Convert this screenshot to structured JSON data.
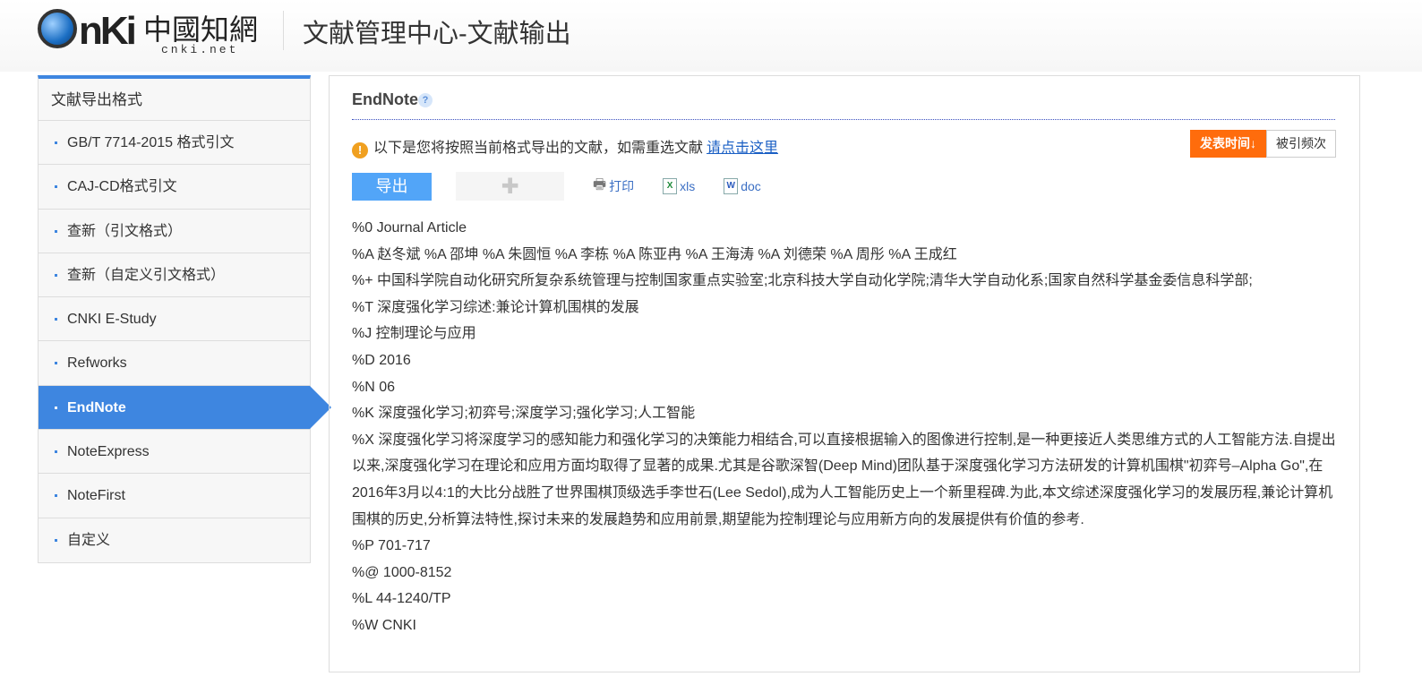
{
  "header": {
    "logo_text": "CNKI中国知网",
    "logo_sub": "cnki.net",
    "title": "文献管理中心-文献输出"
  },
  "sidebar": {
    "title": "文献导出格式",
    "items": [
      {
        "label": "GB/T 7714-2015 格式引文"
      },
      {
        "label": "CAJ-CD格式引文"
      },
      {
        "label": "查新（引文格式）"
      },
      {
        "label": "查新（自定义引文格式）"
      },
      {
        "label": "CNKI E-Study"
      },
      {
        "label": "Refworks"
      },
      {
        "label": "EndNote",
        "active": true
      },
      {
        "label": "NoteExpress"
      },
      {
        "label": "NoteFirst"
      },
      {
        "label": "自定义"
      }
    ]
  },
  "main": {
    "title": "EndNote",
    "help": "?",
    "notice": "以下是您将按照当前格式导出的文献，如需重选文献",
    "notice_link": "请点击这里",
    "sort": {
      "time": "发表时间↓",
      "cited": "被引频次"
    },
    "toolbar": {
      "export": "导出",
      "print": "打印",
      "xls": "xls",
      "doc": "doc"
    },
    "lines": [
      "%0 Journal Article",
      "%A 赵冬斌 %A 邵坤 %A 朱圆恒 %A 李栋 %A 陈亚冉 %A 王海涛 %A 刘德荣 %A 周彤 %A 王成红",
      "%+ 中国科学院自动化研究所复杂系统管理与控制国家重点实验室;北京科技大学自动化学院;清华大学自动化系;国家自然科学基金委信息科学部;",
      "%T 深度强化学习综述:兼论计算机围棋的发展",
      "%J 控制理论与应用",
      "%D 2016",
      "%N 06",
      "%K 深度强化学习;初弈号;深度学习;强化学习;人工智能",
      "%X 深度强化学习将深度学习的感知能力和强化学习的决策能力相结合,可以直接根据输入的图像进行控制,是一种更接近人类思维方式的人工智能方法.自提出以来,深度强化学习在理论和应用方面均取得了显著的成果.尤其是谷歌深智(Deep Mind)团队基于深度强化学习方法研发的计算机围棋\"初弈号–Alpha Go\",在2016年3月以4:1的大比分战胜了世界围棋顶级选手李世石(Lee Sedol),成为人工智能历史上一个新里程碑.为此,本文综述深度强化学习的发展历程,兼论计算机围棋的历史,分析算法特性,探讨未来的发展趋势和应用前景,期望能为控制理论与应用新方向的发展提供有价值的参考.",
      "%P 701-717",
      "%@ 1000-8152",
      "%L 44-1240/TP",
      "%W CNKI"
    ]
  }
}
